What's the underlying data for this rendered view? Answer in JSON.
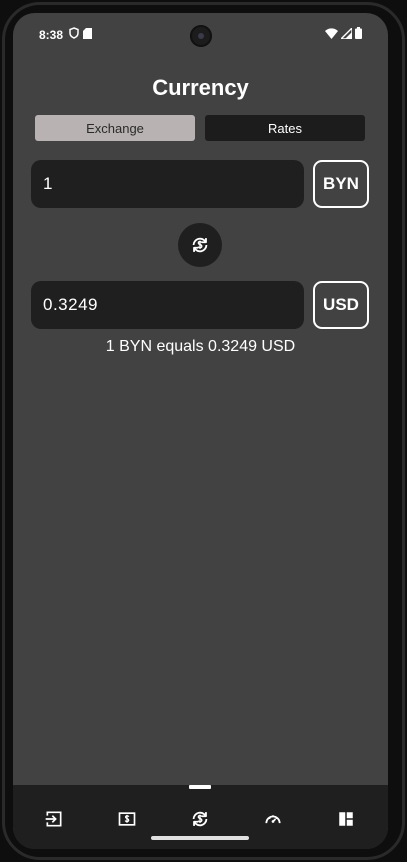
{
  "status_bar": {
    "time": "8:38",
    "left_icons": [
      "shield-icon",
      "sd-card-icon"
    ],
    "right_icons": [
      "wifi-icon",
      "signal-icon",
      "battery-icon"
    ]
  },
  "header": {
    "title": "Currency"
  },
  "tabs": [
    {
      "label": "Exchange",
      "selected": true
    },
    {
      "label": "Rates",
      "selected": false
    }
  ],
  "converter": {
    "from_amount": "1",
    "from_currency": "BYN",
    "to_amount": "0.3249",
    "to_currency": "USD",
    "swap_icon": "currency-swap-icon",
    "equals_text": "1 BYN equals 0.3249 USD"
  },
  "bottom_nav": {
    "items": [
      {
        "icon": "login-icon",
        "selected": false
      },
      {
        "icon": "dollar-bill-icon",
        "selected": false
      },
      {
        "icon": "currency-exchange-icon",
        "selected": true
      },
      {
        "icon": "speedometer-icon",
        "selected": false
      },
      {
        "icon": "dashboard-icon",
        "selected": false
      }
    ]
  },
  "colors": {
    "background": "#424242",
    "field": "#1f1f1f",
    "tab_selected": "#b8b2b2",
    "text": "#ffffff"
  }
}
